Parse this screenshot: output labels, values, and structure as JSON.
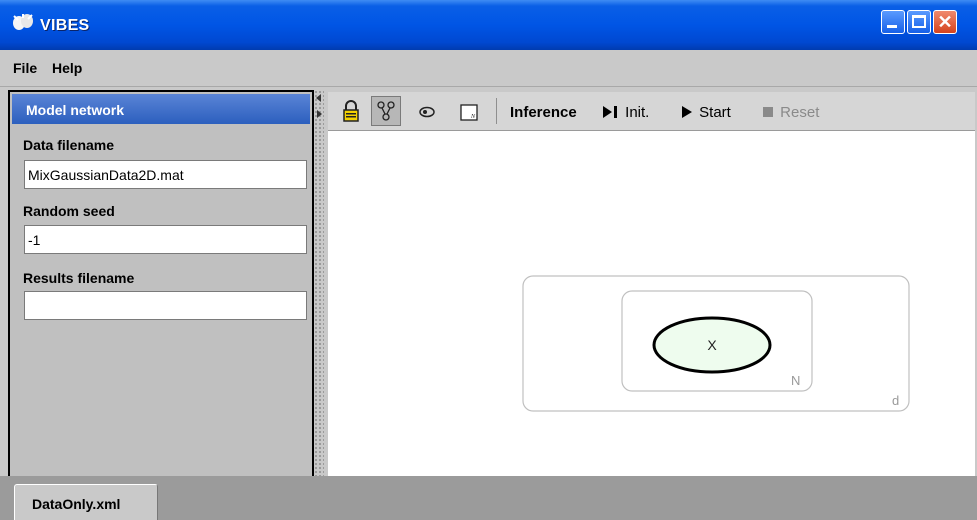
{
  "window": {
    "title": "VIBES"
  },
  "menu": {
    "file": "File",
    "help": "Help"
  },
  "left_panel": {
    "header": "Model network",
    "fields": [
      {
        "label": "Data filename",
        "value": "MixGaussianData2D.mat"
      },
      {
        "label": "Random seed",
        "value": "-1"
      },
      {
        "label": "Results filename",
        "value": ""
      }
    ]
  },
  "toolbar": {
    "icons": [
      "lock-icon",
      "network-icon",
      "node-icon",
      "plate-icon"
    ],
    "inference_label": "Inference",
    "init_label": "Init.",
    "start_label": "Start",
    "reset_label": "Reset",
    "reset_disabled": true
  },
  "graph": {
    "outer_plate_label": "d",
    "inner_plate_label": "N",
    "node_label": "X",
    "node_fill": "#eefcee"
  },
  "tabs": [
    {
      "label": "DataOnly.xml",
      "active": true
    }
  ],
  "colors": {
    "titlebar": "#0055e5",
    "panel_header": "#3b6ccc"
  }
}
